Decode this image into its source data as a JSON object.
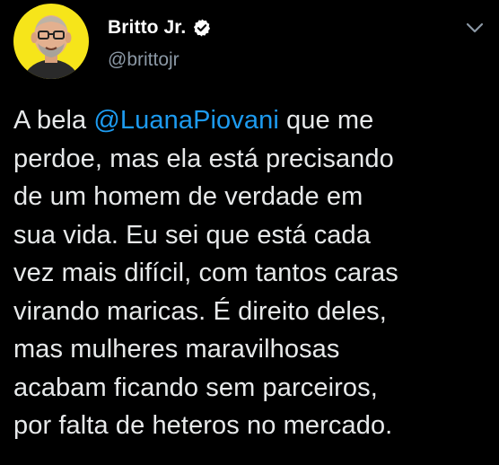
{
  "colors": {
    "background": "#000000",
    "text": "#e7e9ea",
    "secondary_text": "#8b98a5",
    "link": "#1d9bf0",
    "avatar_bg": "#f6e51a"
  },
  "author": {
    "display_name": "Britto Jr.",
    "handle": "@brittojr",
    "verified": true,
    "verified_icon": "verified-badge-icon",
    "avatar_icon": "avatar-photo"
  },
  "menu_icon": "chevron-down-icon",
  "tweet": {
    "line1_prefix": "A bela ",
    "mention": "@LuanaPiovani",
    "line1_suffix": " que me",
    "lines": [
      "perdoe, mas ela está precisando",
      "de um homem de verdade em",
      "sua vida. Eu sei que está cada",
      "vez mais difícil, com tantos caras",
      "virando maricas. É direito deles,",
      "mas mulheres maravilhosas",
      "acabam ficando sem parceiros,",
      "por falta de heteros no mercado."
    ]
  }
}
